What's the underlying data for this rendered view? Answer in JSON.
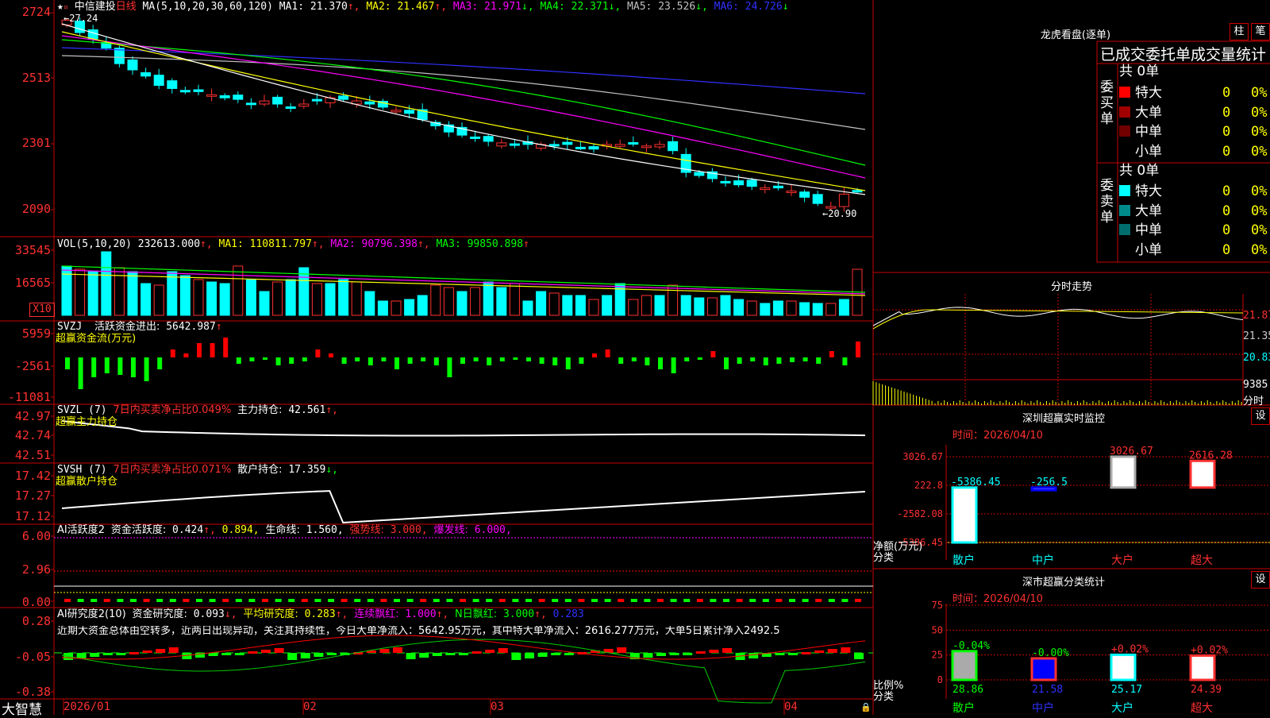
{
  "app": {
    "brand": "大智慧"
  },
  "kline": {
    "stock_name": "中信建投",
    "period": "日线",
    "ma_header": "MA(5,10,20,30,60,120)",
    "ma": [
      {
        "label": "MA1:",
        "value": "21.370",
        "arrow": "↑",
        "color": "#ffffff"
      },
      {
        "label": "MA2:",
        "value": "21.467",
        "arrow": "↑",
        "color": "#ffff00"
      },
      {
        "label": "MA3:",
        "value": "21.971",
        "arrow": "↓",
        "color": "#ff00ff"
      },
      {
        "label": "MA4:",
        "value": "22.371",
        "arrow": "↓",
        "color": "#00ff00"
      },
      {
        "label": "MA5:",
        "value": "23.526",
        "arrow": "↓",
        "color": "#c0c0c0"
      },
      {
        "label": "MA6:",
        "value": "24.726",
        "arrow": "↓",
        "color": "#3030ff"
      }
    ],
    "high_label": "27.24",
    "low_label": "20.90",
    "y_ticks": [
      "2724",
      "2513",
      "2301",
      "2090"
    ]
  },
  "vol": {
    "header": "VOL(5,10,20)",
    "value": "232613.000",
    "ma": [
      {
        "label": "MA1:",
        "value": "110811.797",
        "arrow": "↑",
        "color": "#ffff00"
      },
      {
        "label": "MA2:",
        "value": "90796.398",
        "arrow": "↑",
        "color": "#ff00ff"
      },
      {
        "label": "MA3:",
        "value": "99850.898",
        "arrow": "↑",
        "color": "#00ff00"
      }
    ],
    "y_ticks": [
      "33545",
      "16565"
    ],
    "multiplier": "X10"
  },
  "svzj": {
    "name": "SVZJ",
    "label": "活跃资金进出:",
    "value": "5642.987",
    "arrow": "↑",
    "subtitle": "超赢资金流(万元)",
    "y_ticks": [
      "5959",
      "-2561",
      "-11081"
    ]
  },
  "svzl": {
    "name": "SVZL (7)",
    "text1": "7日内买卖净占比0.049%",
    "label": "主力持仓:",
    "value": "42.561",
    "arrow": "↑,",
    "subtitle": "超赢主力持仓",
    "y_ticks": [
      "42.97",
      "42.74",
      "42.51"
    ]
  },
  "svsh": {
    "name": "SVSH (7)",
    "text1": "7日内买卖净占比0.071%",
    "label": "散户持仓:",
    "value": "17.359",
    "arrow": "↓,",
    "subtitle": "超赢散户持仓",
    "y_ticks": [
      "17.42",
      "17.27",
      "17.12"
    ]
  },
  "ai_active": {
    "name": "AI活跃度2",
    "label": "资金活跃度:",
    "v1": "0.424",
    "v2": "0.894,",
    "label2": "生命线:",
    "v3": "1.560,",
    "label3": "强势线:",
    "v4": "3.000,",
    "label4": "爆发线:",
    "v5": "6.000,",
    "y_ticks": [
      "6.00",
      "2.96",
      "0.00"
    ]
  },
  "ai_research": {
    "name": "AI研究度2(10)",
    "label": "资金研究度:",
    "v1": "0.093",
    "label2": "平均研究度:",
    "v2": "0.283",
    "label3": "连续飘红:",
    "v3": "1.000",
    "label4": "N日飘红:",
    "v4": "3.000",
    "v5": "0.283",
    "commentary": "近期大资金总体由空转多，近两日出现异动，关注其持续性，今日大单净流入：5642.95万元，其中特大单净流入：2616.277万元，大单5日累计净入2492.5",
    "y_ticks": [
      "0.28",
      "-0.05",
      "-0.38"
    ]
  },
  "x_axis": [
    "2026/01",
    "02",
    "03",
    "04"
  ],
  "longhu": {
    "title": "龙虎看盘(逐单)",
    "btn_zhu": "柱",
    "btn_bi": "笔",
    "tabs_title": "已成交委托单成交量统计",
    "buy_side": "委买单",
    "sell_side": "委卖单",
    "buy_total": "共 0单",
    "sell_total": "共 0单",
    "buy_rows": [
      {
        "name": "特大",
        "count": "0",
        "pct": "0%",
        "color": "#ff0000"
      },
      {
        "name": "大单",
        "count": "0",
        "pct": "0%",
        "color": "#a00000"
      },
      {
        "name": "中单",
        "count": "0",
        "pct": "0%",
        "color": "#700000"
      },
      {
        "name": "小单",
        "count": "0",
        "pct": "0%",
        "color": ""
      }
    ],
    "sell_rows": [
      {
        "name": "特大",
        "count": "0",
        "pct": "0%",
        "color": "#00ffff"
      },
      {
        "name": "大单",
        "count": "0",
        "pct": "0%",
        "color": "#008b8b"
      },
      {
        "name": "中单",
        "count": "0",
        "pct": "0%",
        "color": "#006e6e"
      },
      {
        "name": "小单",
        "count": "0",
        "pct": "0%",
        "color": ""
      }
    ]
  },
  "intraday": {
    "title": "分时走势",
    "price_ticks": [
      "21.87",
      "21.35",
      "20.83"
    ],
    "vol_tick": "9385",
    "vol_unit": "分时"
  },
  "sz_monitor": {
    "title": "深圳超赢实时监控",
    "btn": "设",
    "date_label": "时间：2026/04/10",
    "y_ticks": [
      "3026.67",
      "222.8",
      "-2582.08",
      "-5386.45"
    ],
    "ylabel": "净额(万元)",
    "xlabel": "分类",
    "categories": [
      "散户",
      "中户",
      "大户",
      "超大"
    ],
    "values": [
      -5386.45,
      -256.5,
      3026.67,
      2616.28
    ],
    "value_labels": [
      "-5386.45",
      "-256.5",
      "3026.67",
      "2616.28"
    ]
  },
  "sz_class": {
    "title": "深市超赢分类统计",
    "btn": "设",
    "date_label": "时间：2026/04/10",
    "y_ticks": [
      "75",
      "50",
      "25",
      "0"
    ],
    "ylabel": "比例%",
    "xlabel": "分类",
    "categories": [
      "散户",
      "中户",
      "大户",
      "超大"
    ],
    "values": [
      28.86,
      21.58,
      25.17,
      24.39
    ],
    "value_labels": [
      "28.86",
      "21.58",
      "25.17",
      "24.39"
    ],
    "change_labels": [
      "-0.04%",
      "-0.00%",
      "+0.02%",
      "+0.02%"
    ]
  }
}
